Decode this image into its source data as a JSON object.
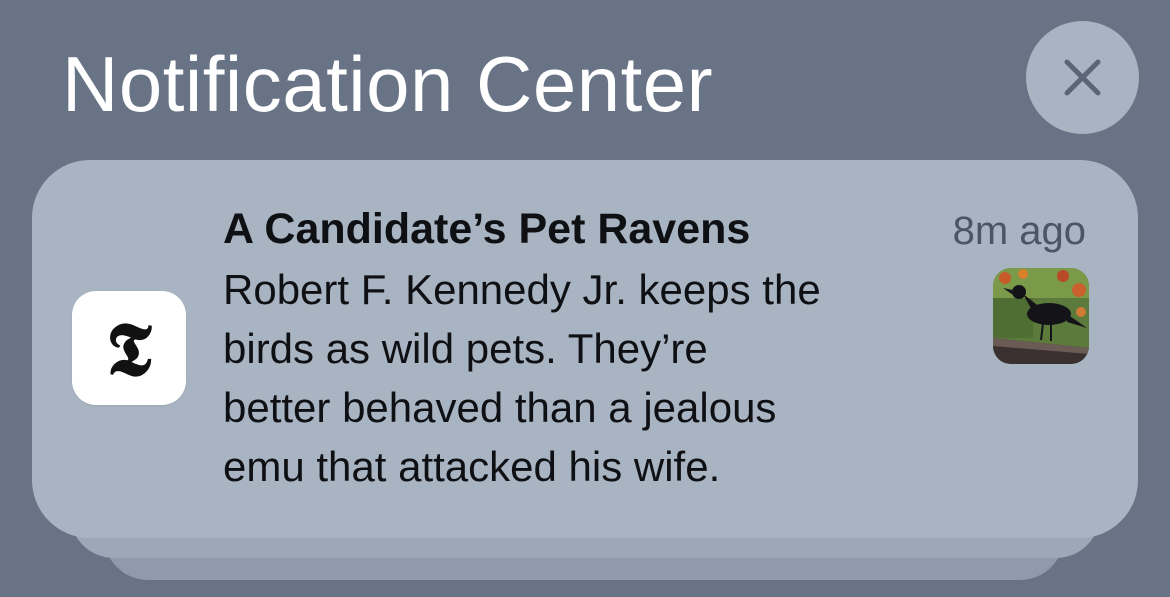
{
  "header": {
    "title": "Notification Center",
    "close_icon": "close-icon"
  },
  "notification": {
    "app_icon": "nyt-logo-icon",
    "app_glyph": "𝕿",
    "title": "A Candidate’s Pet Ravens",
    "time": "8m ago",
    "body_lines": [
      "Robert F. Kennedy Jr. keeps the",
      "birds as wild pets. They’re",
      "better behaved than a jealous",
      "emu that attacked his wife."
    ],
    "thumbnail": "raven-photo-thumbnail"
  },
  "colors": {
    "background": "#687386",
    "card": "#a9b4c3",
    "close_button": "#a9b3c1",
    "title_text": "#ffffff",
    "body_text": "#0f1014",
    "time_text": "#4b5566"
  }
}
